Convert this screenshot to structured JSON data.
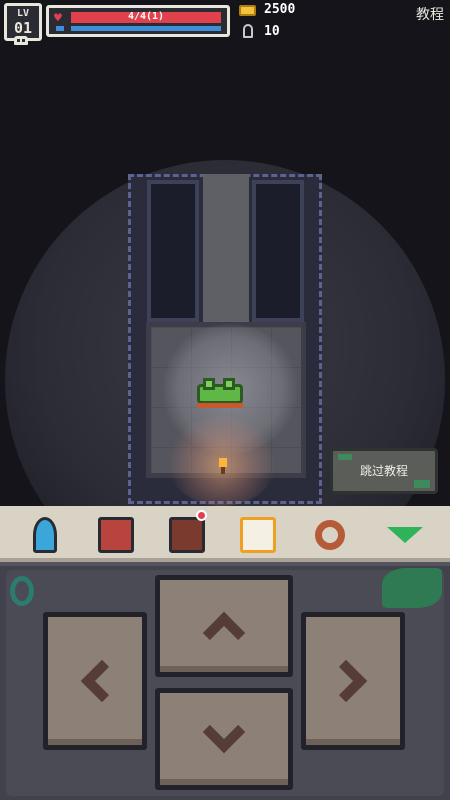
{
  "hud": {
    "level_label": "LV",
    "level_value": "01",
    "hp_text": "4/4(1)",
    "hp_fraction": 1.0,
    "mp_fraction": 1.0,
    "coins": "2500",
    "keys": "10",
    "tutorial_label": "教程"
  },
  "scene": {
    "skip_tutorial_label": "跳过教程",
    "player": "frog",
    "light_source": "torch"
  },
  "toolbar": {
    "items": [
      {
        "name": "character",
        "icon": "character-icon"
      },
      {
        "name": "book",
        "icon": "book-icon"
      },
      {
        "name": "bag",
        "icon": "bag-icon",
        "badge": true
      },
      {
        "name": "map",
        "icon": "map-icon",
        "selected": true
      },
      {
        "name": "search",
        "icon": "magnifier-icon"
      },
      {
        "name": "collapse",
        "icon": "triangle-down-icon"
      }
    ]
  },
  "dpad": {
    "buttons": [
      "up",
      "down",
      "left",
      "right"
    ]
  },
  "colors": {
    "hp": "#e0414d",
    "mp": "#3e8fd8",
    "coin": "#f4c33d",
    "toolbar_bg": "#d9d3c6",
    "dpad": "#8d8077"
  }
}
